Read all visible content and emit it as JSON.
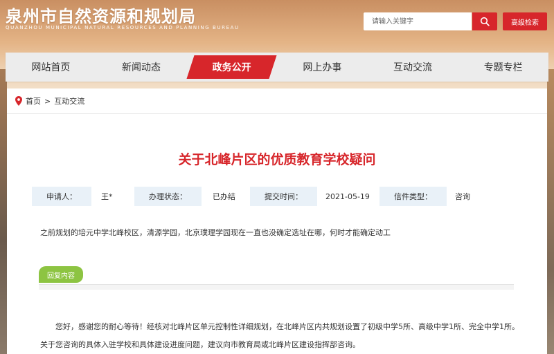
{
  "header": {
    "title": "泉州市自然资源和规划局",
    "subtitle": "QUANZHOU MUNICIPAL NATURAL RESOURCES AND PLANNING BUREAU",
    "search_placeholder": "请输入关键字",
    "advanced_search": "高级检索"
  },
  "nav": {
    "items": [
      "网站首页",
      "新闻动态",
      "政务公开",
      "网上办事",
      "互动交流",
      "专题专栏"
    ],
    "active": "政务公开"
  },
  "breadcrumb": {
    "home": "首页",
    "separator": ">",
    "current": "互动交流"
  },
  "article": {
    "title": "关于北峰片区的优质教育学校疑问",
    "meta": {
      "applicant_label": "申请人：",
      "applicant_value": "王*",
      "status_label": "办理状态：",
      "status_value": "已办结",
      "time_label": "提交时间：",
      "time_value": "2021-05-19",
      "type_label": "信件类型：",
      "type_value": "咨询"
    },
    "question": "之前规划的培元中学北峰校区，清源学园，北京璞理学园现在一直也没确定选址在哪，何时才能确定动工",
    "reply_label": "回复内容",
    "reply": "您好，感谢您的耐心等待！经核对北峰片区单元控制性详细规划，在北峰片区内共规划设置了初级中学5所、高级中学1所、完全中学1所。关于您咨询的具体入驻学校和具体建设进度问题，建议向市教育局或北峰片区建设指挥部咨询。"
  },
  "colors": {
    "accent": "#d7262b",
    "reply_tag": "#8dc442",
    "meta_label_bg": "#e9f1f8"
  }
}
